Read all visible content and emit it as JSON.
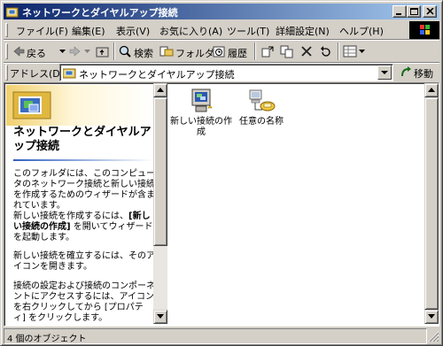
{
  "window": {
    "title": "ネットワークとダイヤルアップ接続",
    "controls": [
      "minimize-icon",
      "maximize-icon",
      "close-icon"
    ]
  },
  "menubar": {
    "items": [
      {
        "label": "ファイル(F)"
      },
      {
        "label": "編集(E)"
      },
      {
        "label": "表示(V)"
      },
      {
        "label": "お気に入り(A)"
      },
      {
        "label": "ツール(T)"
      },
      {
        "label": "詳細設定(N)"
      },
      {
        "label": "ヘルプ(H)"
      }
    ]
  },
  "toolbar": {
    "back_label": "戻る",
    "search_label": "検索",
    "folders_label": "フォルダ",
    "history_label": "履歴"
  },
  "addressbar": {
    "label": "アドレス(D)",
    "value": "ネットワークとダイヤルアップ接続",
    "go_label": "移動"
  },
  "leftpane": {
    "title": "ネットワークとダイヤルアップ接続",
    "paragraphs": [
      "このフォルダには、このコンピュータのネットワーク接続と新しい接続を作成するためのウィザードが含まれています。",
      {
        "before": "新しい接続を作成するには、",
        "bold": "[新しい接続の作成]",
        "after": " を開いてウィザードを起動します。"
      },
      "新しい接続を確立するには、そのアイコンを開きます。",
      "接続の設定および接続のコンポーネントにアクセスするには、アイコンを右クリックしてから [プロパティ] をクリックします。"
    ]
  },
  "items": [
    {
      "name": "新しい接続の作成",
      "icon": "new-connection-icon"
    },
    {
      "name": "任意の名称",
      "icon": "network-connection-icon"
    }
  ],
  "statusbar": {
    "text": "4 個のオブジェクト"
  }
}
